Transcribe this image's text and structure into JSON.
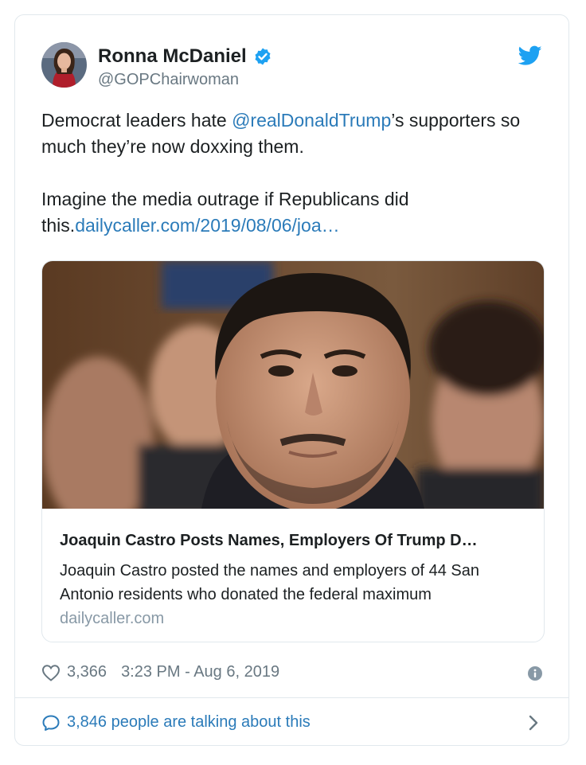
{
  "author": {
    "name": "Ronna McDaniel",
    "handle": "@GOPChairwoman"
  },
  "tweet": {
    "line1_pre": "Democrat leaders hate ",
    "mention": "@realDonaldTrump",
    "line1_post": "’s supporters so much they’re now doxxing them.",
    "para2_pre": "Imagine the media outrage if Republicans did this.",
    "link": "dailycaller.com/2019/08/06/joa…"
  },
  "card": {
    "title": "Joaquin Castro Posts Names, Employers Of Trump D…",
    "description": "Joaquin Castro posted the names and employers of 44 San Antonio residents who donated the federal maximum",
    "domain": "dailycaller.com"
  },
  "meta": {
    "likes": "3,366",
    "timestamp": "3:23 PM - Aug 6, 2019"
  },
  "footer": {
    "talking": "3,846 people are talking about this"
  },
  "icons": {
    "verified": "verified-badge-icon",
    "bird": "twitter-bird-icon",
    "heart": "heart-icon",
    "info": "info-icon",
    "bubble": "speech-bubble-icon",
    "chevron": "chevron-right-icon"
  },
  "colors": {
    "link": "#2b7bb9",
    "verified": "#1da1f2",
    "muted": "#697882"
  }
}
